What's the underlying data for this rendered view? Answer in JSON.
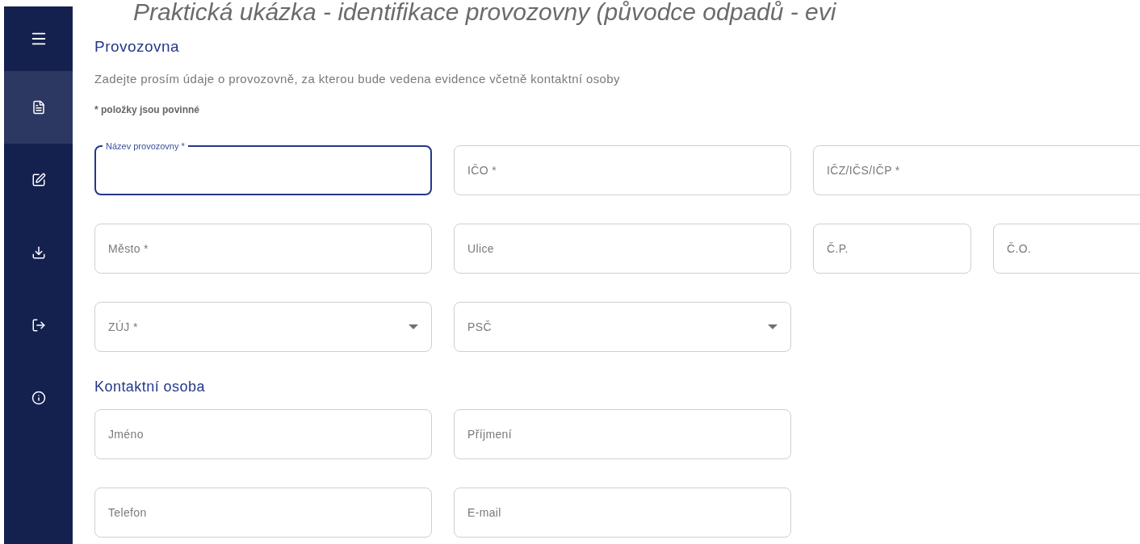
{
  "slide_title": "Praktická ukázka - identifikace provozovny (původce odpadů - evi",
  "sidebar": {
    "items": [
      {
        "selected": true
      },
      {
        "selected": false
      },
      {
        "selected": false
      },
      {
        "selected": false
      },
      {
        "selected": false
      }
    ]
  },
  "section": {
    "title": "Provozovna",
    "description": "Zadejte prosím údaje o provozovně, za kterou bude vedena evidence včetně kontaktní osoby",
    "required_note": "* položky jsou povinné",
    "rows": [
      [
        {
          "label": "Název provozovny *",
          "kind": "text",
          "focused": true
        },
        {
          "label": "IČO *",
          "kind": "text",
          "focused": false
        },
        {
          "label": "IČZ/IČS/IČP *",
          "kind": "text",
          "focused": false
        }
      ],
      [
        {
          "label": "Město *",
          "kind": "text",
          "focused": false
        },
        {
          "label": "Ulice",
          "kind": "text",
          "focused": false
        },
        {
          "label": "Č.P.",
          "kind": "short",
          "focused": false
        },
        {
          "label": "Č.O.",
          "kind": "short",
          "focused": false
        }
      ],
      [
        {
          "label": "ZÚJ *",
          "kind": "select",
          "focused": false
        },
        {
          "label": "PSČ",
          "kind": "select",
          "focused": false
        }
      ]
    ]
  },
  "contact": {
    "title": "Kontaktní osoba",
    "rows": [
      [
        {
          "label": "Jméno",
          "kind": "text",
          "focused": false
        },
        {
          "label": "Příjmení",
          "kind": "text",
          "focused": false
        }
      ],
      [
        {
          "label": "Telefon",
          "kind": "text",
          "focused": false
        },
        {
          "label": "E-mail",
          "kind": "text",
          "focused": false
        }
      ]
    ]
  }
}
